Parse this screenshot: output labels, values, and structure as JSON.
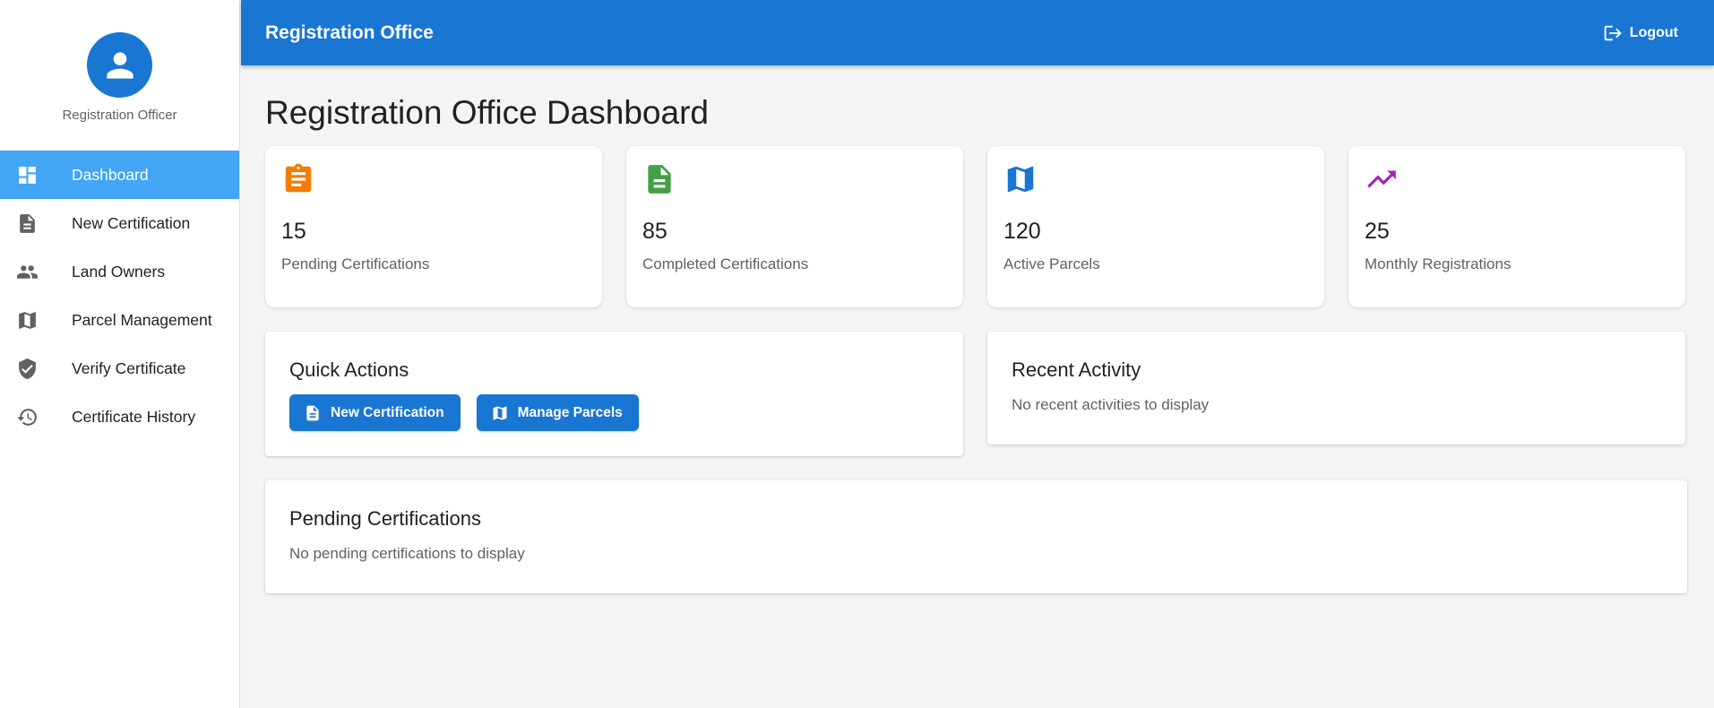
{
  "sidebar": {
    "role": "Registration Officer",
    "items": [
      {
        "label": "Dashboard",
        "icon": "dashboard-icon",
        "active": true
      },
      {
        "label": "New Certification",
        "icon": "document-icon"
      },
      {
        "label": "Land Owners",
        "icon": "people-icon"
      },
      {
        "label": "Parcel Management",
        "icon": "map-icon"
      },
      {
        "label": "Verify Certificate",
        "icon": "shield-check-icon"
      },
      {
        "label": "Certificate History",
        "icon": "history-icon"
      }
    ]
  },
  "header": {
    "title": "Registration Office",
    "logout_label": "Logout"
  },
  "main": {
    "title": "Registration Office Dashboard",
    "stats": [
      {
        "value": "15",
        "label": "Pending Certifications",
        "icon": "clipboard-icon",
        "color": "#f57c00"
      },
      {
        "value": "85",
        "label": "Completed Certifications",
        "icon": "document-icon",
        "color": "#43a047"
      },
      {
        "value": "120",
        "label": "Active Parcels",
        "icon": "map-icon",
        "color": "#1976d2"
      },
      {
        "value": "25",
        "label": "Monthly Registrations",
        "icon": "trending-up-icon",
        "color": "#9c27b0"
      }
    ],
    "quick_actions": {
      "title": "Quick Actions",
      "new_certification": "New Certification",
      "manage_parcels": "Manage Parcels"
    },
    "recent_activity": {
      "title": "Recent Activity",
      "empty": "No recent activities to display"
    },
    "pending_certifications": {
      "title": "Pending Certifications",
      "empty": "No pending certifications to display"
    }
  },
  "colors": {
    "primary": "#1976d2",
    "active_nav": "#42a5f5",
    "background": "#f4f4f4"
  }
}
